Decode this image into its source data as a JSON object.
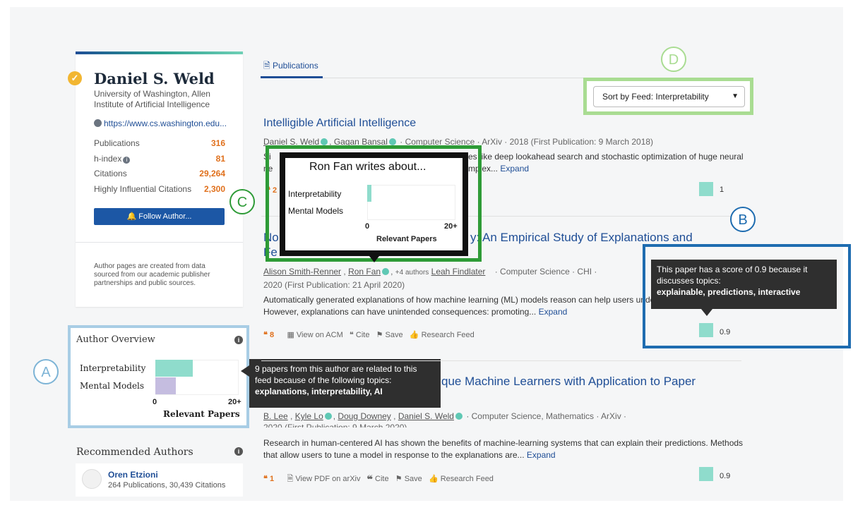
{
  "author": {
    "name": "Daniel S. Weld",
    "affiliation": "University of Washington, Allen Institute of Artificial Intelligence",
    "homepage": "https://www.cs.washington.edu...",
    "stats": [
      {
        "label": "Publications",
        "value": "316"
      },
      {
        "label": "h-index",
        "value": "81"
      },
      {
        "label": "Citations",
        "value": "29,264"
      },
      {
        "label": "Highly Influential Citations",
        "value": "2,300"
      }
    ],
    "follow_label": "Follow Author...",
    "note": "Author pages are created from data sourced from our academic publisher partnerships and public sources."
  },
  "overview": {
    "title": "Author Overview",
    "rows": [
      "Interpretability",
      "Mental Models"
    ],
    "axis_min": "0",
    "axis_max": "20+",
    "axis_label": "Relevant Papers",
    "tooltip_text": "9 papers from this author are related to this feed because of the following topics:",
    "tooltip_topics": "explanations, interpretability, AI"
  },
  "callouts": {
    "a": "A",
    "b": "B",
    "c": "C",
    "d": "D"
  },
  "recommended": {
    "title": "Recommended Authors",
    "name": "Oren Etzioni",
    "sub": "264 Publications, 30,439 Citations"
  },
  "tabs": {
    "publications": "Publications"
  },
  "sort": {
    "value": "Sort by Feed: Interpretability"
  },
  "papers": [
    {
      "title": "Intelligible Artificial Intelligence",
      "authors": [
        "Daniel S. Weld",
        "Gagan Bansal"
      ],
      "meta": "· Computer Science · ArXiv · 2018 (First Publication: 9 March 2018)",
      "abstract_a": "Si",
      "abstract_b": "es like deep lookahead search and stochastic optimization of huge neural",
      "abstract_c": "ne",
      "abstract_d": "mplex...",
      "expand": "Expand",
      "cites": "2",
      "score": "1"
    },
    {
      "title_a": "No",
      "title_b": "y: An Empirical Study of Explanations and",
      "title_c": "Fe",
      "authors": [
        "Alison Smith-Renner",
        "Ron Fan"
      ],
      "more_authors": "+4 authors",
      "author_last": "Leah Findlater",
      "meta": "· Computer Science · CHI ·",
      "meta2": "2020 (First Publication: 21 April 2020)",
      "abstract": "Automatically generated explanations of how machine learning (ML) models reason can help users unde",
      "abstract2": "However, explanations can have unintended consequences: promoting...",
      "expand": "Expand",
      "cites": "8",
      "view": "View on ACM",
      "cite": "Cite",
      "save": "Save",
      "feed": "Research Feed",
      "score": "0.9"
    },
    {
      "title": "que Machine Learners with Application to Paper",
      "authors": [
        "B. Lee",
        "Kyle Lo",
        "Doug Downey",
        "Daniel S. Weld"
      ],
      "meta": "· Computer Science, Mathematics · ArXiv ·",
      "meta2": "2020 (First Publication: 9 March 2020)",
      "abstract": "Research in human-centered AI has shown the benefits of machine-learning systems that can explain their predictions. Methods",
      "abstract2": "that allow users to tune a model in response to the explanations are...",
      "expand": "Expand",
      "cites": "1",
      "view": "View PDF on arXiv",
      "cite": "Cite",
      "save": "Save",
      "feed": "Research Feed",
      "score": "0.9"
    }
  ],
  "ron_tooltip": {
    "title": "Ron Fan writes about...",
    "rows": [
      "Interpretability",
      "Mental Models"
    ],
    "axis_min": "0",
    "axis_max": "20+",
    "axis_label": "Relevant Papers"
  },
  "score_tooltip": {
    "text": "This paper has a score of 0.9 because it discusses topics:",
    "topics": "explainable, predictions, interactive"
  },
  "colors": {
    "accent_blue": "#1f4e96",
    "callout_a": "#a8cde5",
    "callout_b": "#1e6cb0",
    "callout_c": "#2e9b37",
    "callout_d": "#a9dc92",
    "score_teal": "#8fdccc",
    "secondary_bar": "#c5bde0"
  }
}
